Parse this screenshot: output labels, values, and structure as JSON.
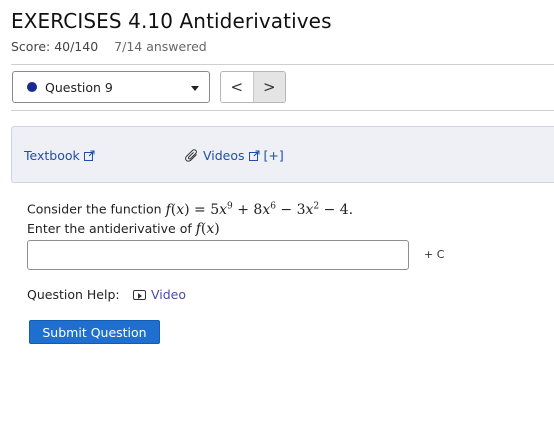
{
  "header": {
    "title": "EXERCISES 4.10 Antiderivatives",
    "score": "Score: 40/140",
    "answered": "7/14 answered"
  },
  "question_nav": {
    "selected": "Question 9",
    "prev_label": "<",
    "next_label": ">",
    "dot_color": "#1a2a8c"
  },
  "resources": {
    "textbook_label": "Textbook",
    "videos_label": "Videos",
    "expand_label": "[+]"
  },
  "problem": {
    "consider_prefix": "Consider the function",
    "function_text": "f(x) = 5x^9 + 8x^6 - 3x^2 - 4.",
    "enter_prefix": "Enter the antiderivative of",
    "enter_function": "f(x)",
    "answer_value": "",
    "constant_label": "+ C"
  },
  "help": {
    "label": "Question Help:",
    "video_label": "Video"
  },
  "submit_label": "Submit Question",
  "colors": {
    "link": "#1f4fa6",
    "submit_bg": "#1f6fd1",
    "resource_bg": "#eef0f5"
  }
}
